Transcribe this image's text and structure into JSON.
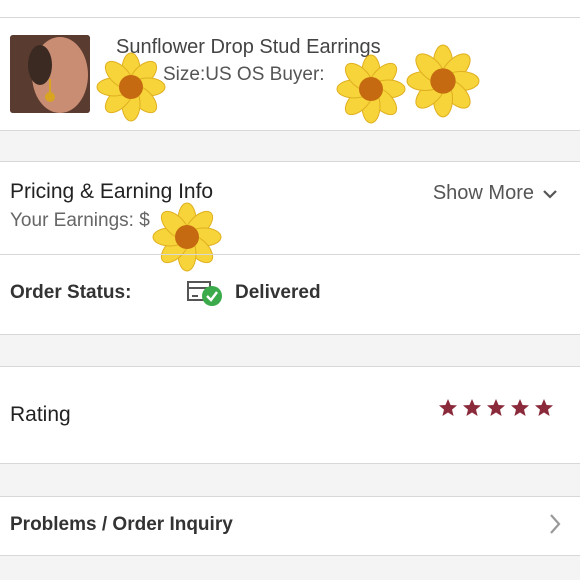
{
  "item": {
    "title": "Sunflower Drop Stud Earrings",
    "size_line": "Size:US OS  Buyer: "
  },
  "pricing": {
    "heading": "Pricing & Earning Info",
    "show_more": "Show More",
    "earnings_label": "Your Earnings: $"
  },
  "order": {
    "status_label": "Order Status:",
    "status_value": "Delivered"
  },
  "rating": {
    "label": "Rating",
    "stars": 5,
    "star_color": "#8b2a3a"
  },
  "inquiry": {
    "label": "Problems / Order Inquiry"
  },
  "colors": {
    "divider": "#d8d8d8",
    "section_gap": "#f4f4f4",
    "delivered_green": "#3aaa4a",
    "petal": "#f6d43a",
    "flower_center": "#c56a10"
  }
}
